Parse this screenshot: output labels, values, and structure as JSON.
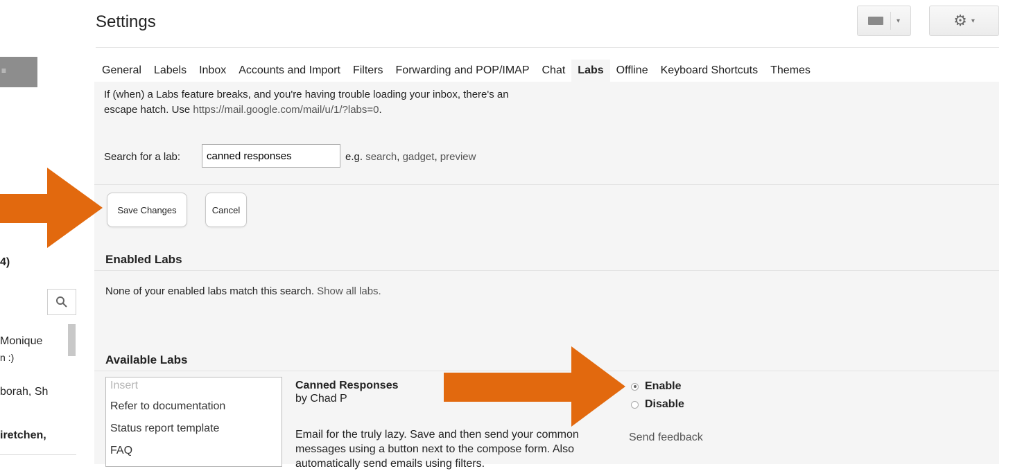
{
  "header": {
    "title": "Settings",
    "keyboard_icon": "keyboard-icon",
    "settings_icon": "gear-icon"
  },
  "left_panel": {
    "count_text": "4)",
    "monique": "Monique",
    "smile": "n :)",
    "borah": "borah, Sh",
    "gretchen": "iretchen,"
  },
  "tabs": [
    {
      "label": "General",
      "active": false
    },
    {
      "label": "Labels",
      "active": false
    },
    {
      "label": "Inbox",
      "active": false
    },
    {
      "label": "Accounts and Import",
      "active": false
    },
    {
      "label": "Filters",
      "active": false
    },
    {
      "label": "Forwarding and POP/IMAP",
      "active": false
    },
    {
      "label": "Chat",
      "active": false
    },
    {
      "label": "Labs",
      "active": true
    },
    {
      "label": "Offline",
      "active": false
    },
    {
      "label": "Keyboard Shortcuts",
      "active": false
    },
    {
      "label": "Themes",
      "active": false
    }
  ],
  "escape": {
    "line1": "If (when) a Labs feature breaks, and you're having trouble loading your inbox, there's an",
    "line2_prefix": "escape hatch. Use ",
    "line2_link": "https://mail.google.com/mail/u/1/?labs=0",
    "line2_suffix": "."
  },
  "search": {
    "label": "Search for a lab:",
    "value": "canned responses",
    "eg_prefix": "e.g. ",
    "eg_1": "search",
    "eg_2": "gadget",
    "eg_3": "preview",
    "sep": ", "
  },
  "buttons": {
    "save": "Save Changes",
    "cancel": "Cancel"
  },
  "enabled_labs": {
    "heading": "Enabled Labs",
    "message": "None of your enabled labs match this search. ",
    "show_all": "Show all labs."
  },
  "available_labs": {
    "heading": "Available Labs",
    "templates": {
      "placeholder": "Insert",
      "items": [
        "Refer to documentation",
        "Status report template",
        "FAQ"
      ]
    },
    "lab": {
      "name": "Canned Responses",
      "author": "by Chad P",
      "description": "Email for the truly lazy. Save and then send your common messages using a button next to the compose form. Also automatically send emails using filters.",
      "enable": "Enable",
      "disable": "Disable",
      "enabled": true,
      "feedback": "Send feedback"
    }
  },
  "colors": {
    "arrow": "#e2690e",
    "panel": "#f5f5f5"
  }
}
